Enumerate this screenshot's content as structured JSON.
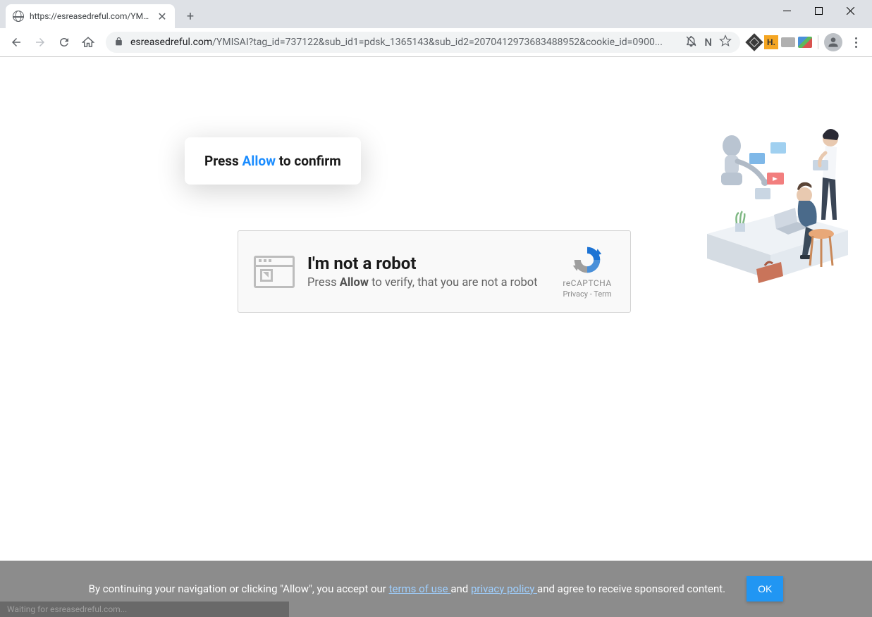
{
  "browser": {
    "tab_title": "https://esreasedreful.com/YMISA",
    "url_domain": "esreasedreful.com",
    "url_path": "/YMISAI?tag_id=737122&sub_id1=pdsk_1365143&sub_id2=2070412973683488952&cookie_id=0900...",
    "ext_letter_n": "N",
    "ext_orange_label": "H."
  },
  "allow_bubble": {
    "prefix": "Press ",
    "allow": "Allow",
    "suffix": " to confirm"
  },
  "captcha": {
    "title": "I'm not a robot",
    "sub_prefix": "Press ",
    "sub_bold": "Allow",
    "sub_suffix": " to verify, that you are not a robot",
    "badge_label": "reCAPTCHA",
    "privacy": "Privacy",
    "terms": "Term"
  },
  "cookie": {
    "text_prefix": "By continuing your navigation or clicking \"Allow\", you accept our ",
    "terms_link": "terms of use ",
    "and1": "and ",
    "privacy_link": "privacy policy ",
    "text_suffix": "and agree to receive sponsored content.",
    "ok": "OK"
  },
  "status": "Waiting for esreasedreful.com..."
}
